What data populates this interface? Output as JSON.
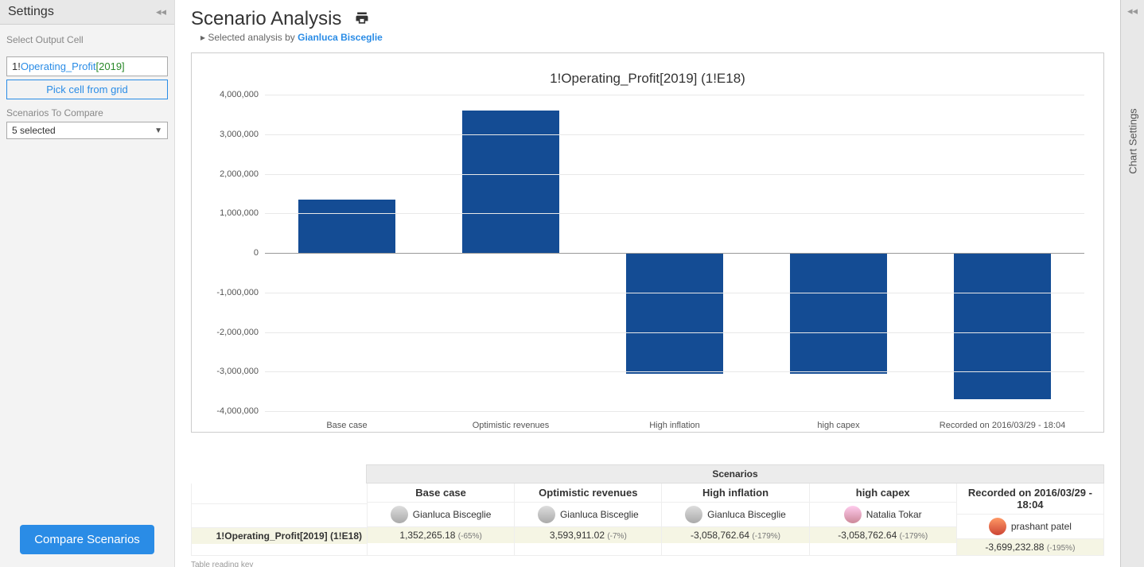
{
  "sidebar": {
    "title": "Settings",
    "output_label": "Select Output Cell",
    "cell_ref_prefix": "1!",
    "cell_ref_name": "Operating_Profit",
    "cell_ref_year": "[2019]",
    "pick_cell": "Pick cell from grid",
    "scenarios_label": "Scenarios To Compare",
    "scenarios_selected": "5 selected",
    "compare_button": "Compare Scenarios"
  },
  "header": {
    "title": "Scenario Analysis",
    "subtitle_prefix": "Selected analysis by",
    "subtitle_author": "Gianluca Bisceglie"
  },
  "chart_data": {
    "type": "bar",
    "title": "1!Operating_Profit[2019] (1!E18)",
    "categories": [
      "Base case",
      "Optimistic revenues",
      "High inflation",
      "high capex",
      "Recorded on 2016/03/29 - 18:04"
    ],
    "values": [
      1352265.18,
      3593911.02,
      -3058762.64,
      -3058762.64,
      -3699232.88
    ],
    "ylim": [
      -4000000,
      4000000
    ],
    "yticks": [
      -4000000,
      -3000000,
      -2000000,
      -1000000,
      0,
      1000000,
      2000000,
      3000000,
      4000000
    ],
    "ytick_labels": [
      "-4,000,000",
      "-3,000,000",
      "-2,000,000",
      "-1,000,000",
      "0",
      "1,000,000",
      "2,000,000",
      "3,000,000",
      "4,000,000"
    ]
  },
  "table": {
    "header": "Scenarios",
    "row_label": "1!Operating_Profit[2019] (1!E18)",
    "columns": [
      {
        "name": "Base case",
        "user": "Gianluca Bisceglie",
        "value": "1,352,265.18",
        "pct": "(-65%)",
        "avatar": "a1"
      },
      {
        "name": "Optimistic revenues",
        "user": "Gianluca Bisceglie",
        "value": "3,593,911.02",
        "pct": "(-7%)",
        "avatar": "a1"
      },
      {
        "name": "High inflation",
        "user": "Gianluca Bisceglie",
        "value": "-3,058,762.64",
        "pct": "(-179%)",
        "avatar": "a1"
      },
      {
        "name": "high capex",
        "user": "Natalia Tokar",
        "value": "-3,058,762.64",
        "pct": "(-179%)",
        "avatar": "a2"
      },
      {
        "name": "Recorded on 2016/03/29 - 18:04",
        "user": "prashant patel",
        "value": "-3,699,232.88",
        "pct": "(-195%)",
        "avatar": "a3"
      }
    ],
    "footnote": "Table reading key"
  },
  "right_rail": {
    "label": "Chart Settings"
  }
}
